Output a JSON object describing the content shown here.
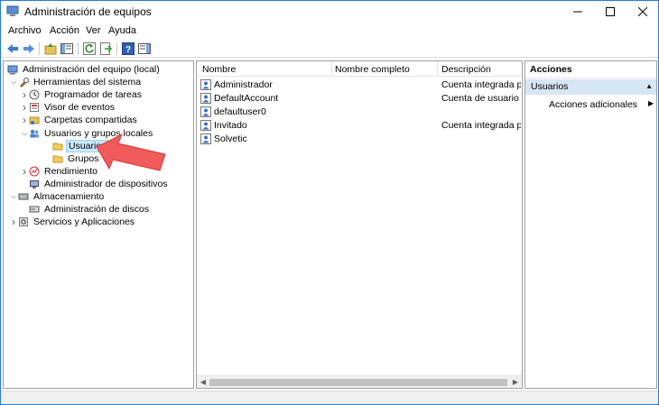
{
  "window": {
    "title": "Administración de equipos"
  },
  "menu": [
    {
      "label": "Archivo"
    },
    {
      "label": "Acción"
    },
    {
      "label": "Ver"
    },
    {
      "label": "Ayuda"
    }
  ],
  "tree": [
    {
      "label": "Administración del equipo (local)",
      "icon": "computer-icon",
      "level": 0,
      "expander": "none"
    },
    {
      "label": "Herramientas del sistema",
      "icon": "tools-icon",
      "level": 1,
      "expander": "expanded"
    },
    {
      "label": "Programador de tareas",
      "icon": "clock-icon",
      "level": 2,
      "expander": "collapsed"
    },
    {
      "label": "Visor de eventos",
      "icon": "event-viewer-icon",
      "level": 2,
      "expander": "collapsed"
    },
    {
      "label": "Carpetas compartidas",
      "icon": "shared-folder-icon",
      "level": 2,
      "expander": "collapsed"
    },
    {
      "label": "Usuarios y grupos locales",
      "icon": "users-groups-icon",
      "level": 2,
      "expander": "expanded"
    },
    {
      "label": "Usuarios",
      "icon": "folder-icon",
      "level": 3,
      "expander": "none",
      "selected": true
    },
    {
      "label": "Grupos",
      "icon": "folder-icon",
      "level": 3,
      "expander": "none"
    },
    {
      "label": "Rendimiento",
      "icon": "performance-icon",
      "level": 2,
      "expander": "collapsed"
    },
    {
      "label": "Administrador de dispositivos",
      "icon": "device-manager-icon",
      "level": 2,
      "expander": "none"
    },
    {
      "label": "Almacenamiento",
      "icon": "storage-icon",
      "level": 1,
      "expander": "expanded"
    },
    {
      "label": "Administración de discos",
      "icon": "disk-icon",
      "level": 2,
      "expander": "none"
    },
    {
      "label": "Servicios y Aplicaciones",
      "icon": "services-icon",
      "level": 1,
      "expander": "collapsed"
    }
  ],
  "list": {
    "columns": [
      "Nombre",
      "Nombre completo",
      "Descripción"
    ],
    "rows": [
      {
        "name": "Administrador",
        "full_name": "",
        "description": "Cuenta integrada para"
      },
      {
        "name": "DefaultAccount",
        "full_name": "",
        "description": "Cuenta de usuario ad"
      },
      {
        "name": "defaultuser0",
        "full_name": "",
        "description": ""
      },
      {
        "name": "Invitado",
        "full_name": "",
        "description": "Cuenta integrada para"
      },
      {
        "name": "Solvetic",
        "full_name": "",
        "description": ""
      }
    ]
  },
  "actions": {
    "title": "Acciones",
    "section": "Usuarios",
    "item": "Acciones adicionales"
  },
  "colors": {
    "selection": "#cce8ff",
    "actions_section": "#d7e6f5",
    "arrow": "#f05a5a"
  }
}
